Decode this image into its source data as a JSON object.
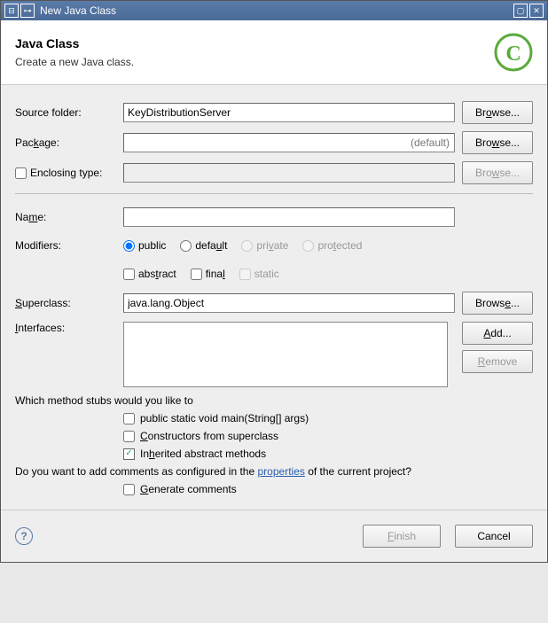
{
  "window": {
    "title": "New Java Class"
  },
  "header": {
    "title": "Java Class",
    "subtitle": "Create a new Java class."
  },
  "labels": {
    "source_folder": "Source folder:",
    "package": "Package:",
    "enclosing_type": "Enclosing type:",
    "name": "Name:",
    "modifiers": "Modifiers:",
    "superclass": "Superclass:",
    "interfaces": "Interfaces:"
  },
  "values": {
    "source_folder": "KeyDistributionServer",
    "package": "",
    "package_default": "(default)",
    "enclosing_type": "",
    "name": "",
    "superclass": "java.lang.Object",
    "interfaces": ""
  },
  "buttons": {
    "browse": "Browse...",
    "add": "Add...",
    "remove": "Remove",
    "finish": "Finish",
    "cancel": "Cancel"
  },
  "radios": {
    "public": "public",
    "default": "default",
    "private": "private",
    "protected": "protected"
  },
  "checks": {
    "abstract": "abstract",
    "final": "final",
    "static": "static"
  },
  "stubs": {
    "question": "Which method stubs would you like to",
    "main": "public static void main(String[] args)",
    "constructors": "Constructors from superclass",
    "inherited": "Inherited abstract methods"
  },
  "comments": {
    "question_pre": "Do you want to add comments as configured in the ",
    "properties_link": "properties",
    "question_post": " of the current project?",
    "generate": "Generate comments"
  }
}
